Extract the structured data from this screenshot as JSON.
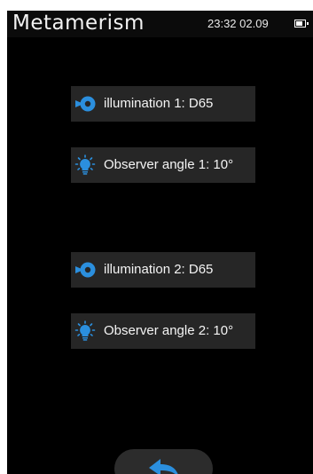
{
  "header": {
    "title": "Metamerism",
    "time": "23:32",
    "date": "02.09",
    "battery_icon": "battery-icon"
  },
  "settings": [
    {
      "label": "illumination 1: D65",
      "icon": "illumination-icon"
    },
    {
      "label": "Observer angle 1: 10°",
      "icon": "observer-lightbulb-icon"
    },
    {
      "label": "illumination 2: D65",
      "icon": "illumination-icon"
    },
    {
      "label": "Observer angle 2: 10°",
      "icon": "observer-lightbulb-icon"
    }
  ],
  "footer": {
    "back_icon": "back-arrow-icon"
  },
  "colors": {
    "background": "#000000",
    "button": "#262626",
    "accent": "#2b8fde",
    "text": "#f4f4f4"
  }
}
